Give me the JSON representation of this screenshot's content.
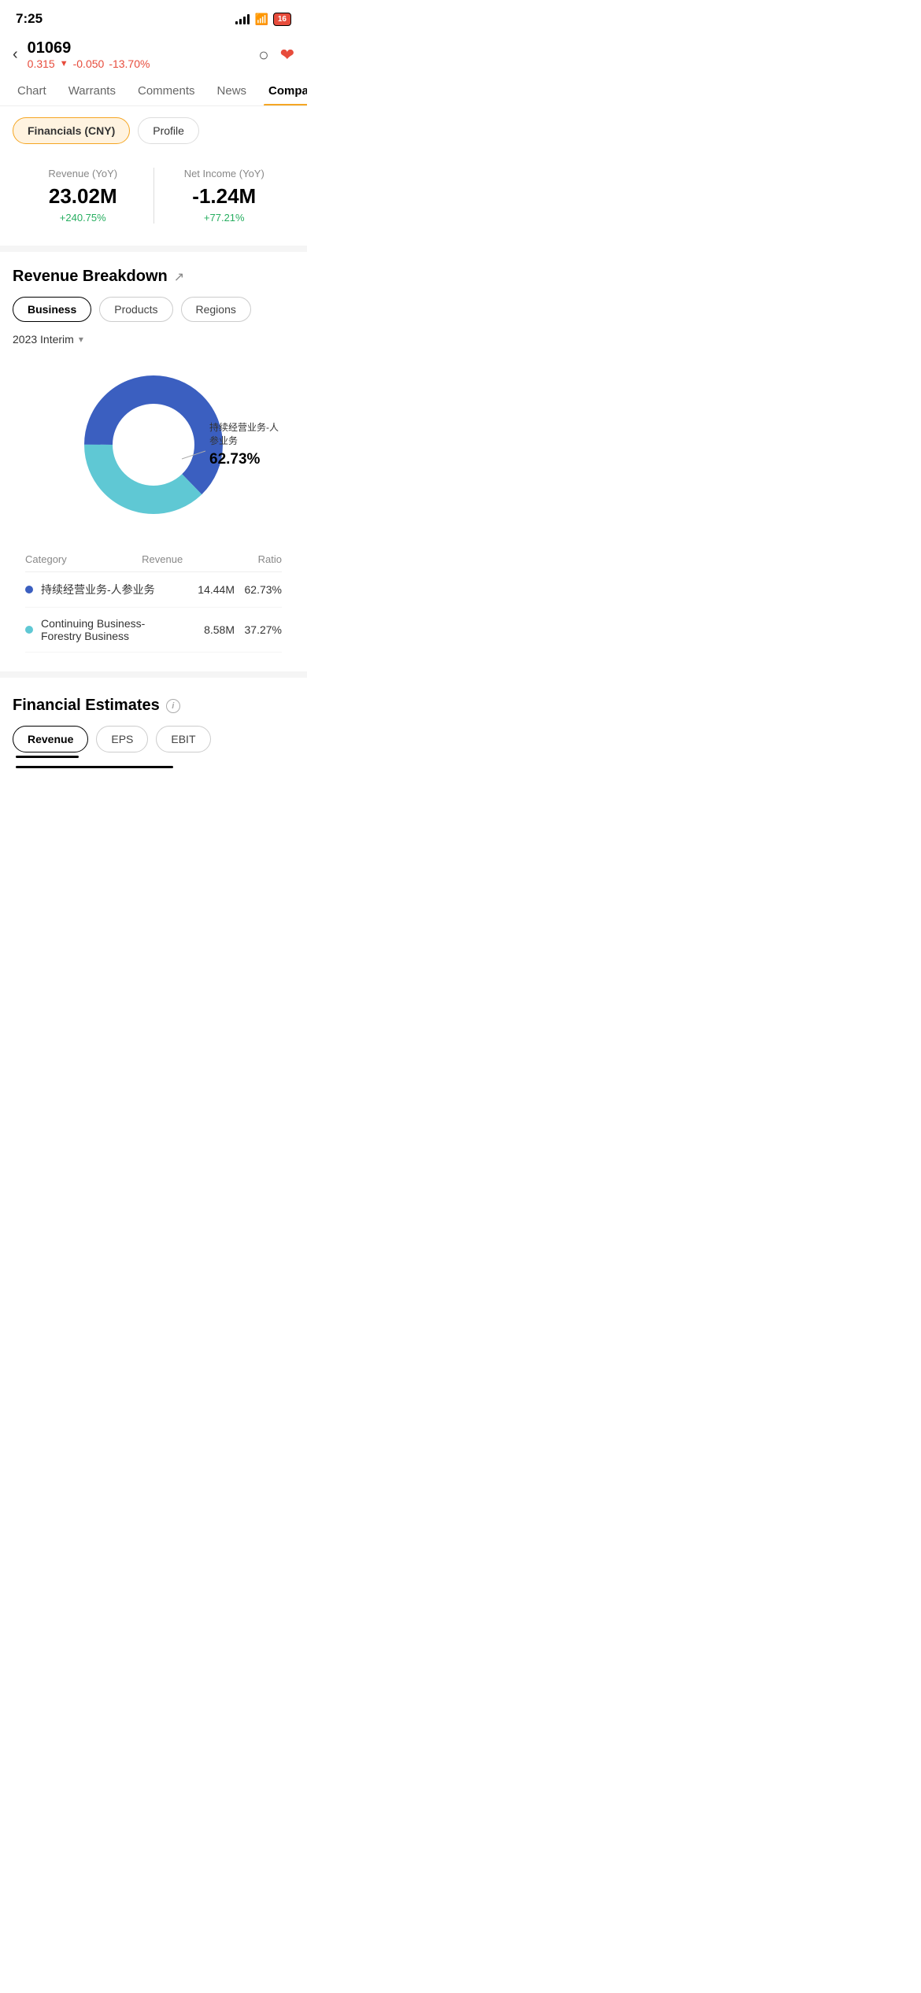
{
  "statusBar": {
    "time": "7:25",
    "battery": "16"
  },
  "header": {
    "ticker": "01069",
    "price": "0.315",
    "priceChange": "-0.050",
    "priceChangePct": "-13.70%",
    "downArrow": "▼"
  },
  "navTabs": [
    {
      "id": "chart",
      "label": "Chart"
    },
    {
      "id": "warrants",
      "label": "Warrants"
    },
    {
      "id": "comments",
      "label": "Comments"
    },
    {
      "id": "news",
      "label": "News"
    },
    {
      "id": "company",
      "label": "Company",
      "active": true
    }
  ],
  "subTabs": [
    {
      "id": "financials",
      "label": "Financials (CNY)",
      "active": true
    },
    {
      "id": "profile",
      "label": "Profile"
    }
  ],
  "financials": {
    "revenue": {
      "label": "Revenue (YoY)",
      "value": "23.02M",
      "change": "+240.75%"
    },
    "netIncome": {
      "label": "Net Income (YoY)",
      "value": "-1.24M",
      "change": "+77.21%"
    }
  },
  "revenueBreakdown": {
    "title": "Revenue Breakdown",
    "segmentTabs": [
      {
        "id": "business",
        "label": "Business",
        "active": true
      },
      {
        "id": "products",
        "label": "Products"
      },
      {
        "id": "regions",
        "label": "Regions"
      }
    ],
    "period": "2023 Interim",
    "chartData": [
      {
        "label": "持续经营业务-人参业务",
        "pct": 62.73,
        "color": "#3b5fc0"
      },
      {
        "label": "Continuing Business-Forestry Business",
        "pct": 37.27,
        "color": "#5fc8d4"
      }
    ],
    "highlightLabel": "持续经营业务-人\n参业务",
    "highlightPct": "62.73%",
    "tableHeader": {
      "category": "Category",
      "revenue": "Revenue",
      "ratio": "Ratio"
    },
    "tableRows": [
      {
        "label": "持续经营业务-人参业务",
        "revenue": "14.44M",
        "ratio": "62.73%",
        "color": "#3b5fc0"
      },
      {
        "label": "Continuing Business-Forestry Business",
        "revenue": "8.58M",
        "ratio": "37.27%",
        "color": "#5fc8d4"
      }
    ]
  },
  "financialEstimates": {
    "title": "Financial Estimates",
    "tabs": [
      {
        "id": "revenue",
        "label": "Revenue",
        "active": true
      },
      {
        "id": "eps",
        "label": "EPS"
      },
      {
        "id": "ebit",
        "label": "EBIT"
      }
    ]
  }
}
